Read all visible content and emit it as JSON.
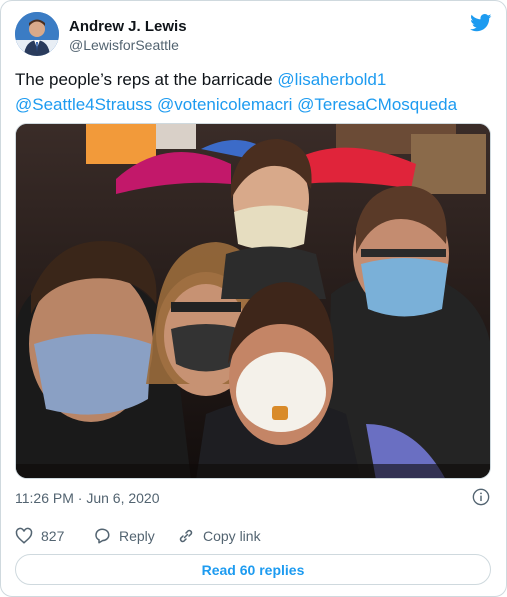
{
  "author": {
    "display_name": "Andrew J. Lewis",
    "handle": "@LewisforSeattle"
  },
  "tweet": {
    "text_prefix": "The people’s reps at the barricade ",
    "mentions": [
      "@lisaherbold1",
      "@Seattle4Strauss",
      "@votenicolemacri",
      "@TeresaCMosqueda"
    ]
  },
  "meta": {
    "timestamp": "11:26 PM · Jun 6, 2020"
  },
  "actions": {
    "like_count": "827",
    "reply_label": "Reply",
    "copy_label": "Copy link"
  },
  "read_replies_label": "Read 60 replies",
  "colors": {
    "accent": "#1d9bf0",
    "secondary_text": "#536471",
    "border": "#cfd9de",
    "text": "#0f1419"
  },
  "icons": [
    "twitter-bird-icon",
    "info-icon",
    "heart-icon",
    "reply-icon",
    "link-icon"
  ]
}
